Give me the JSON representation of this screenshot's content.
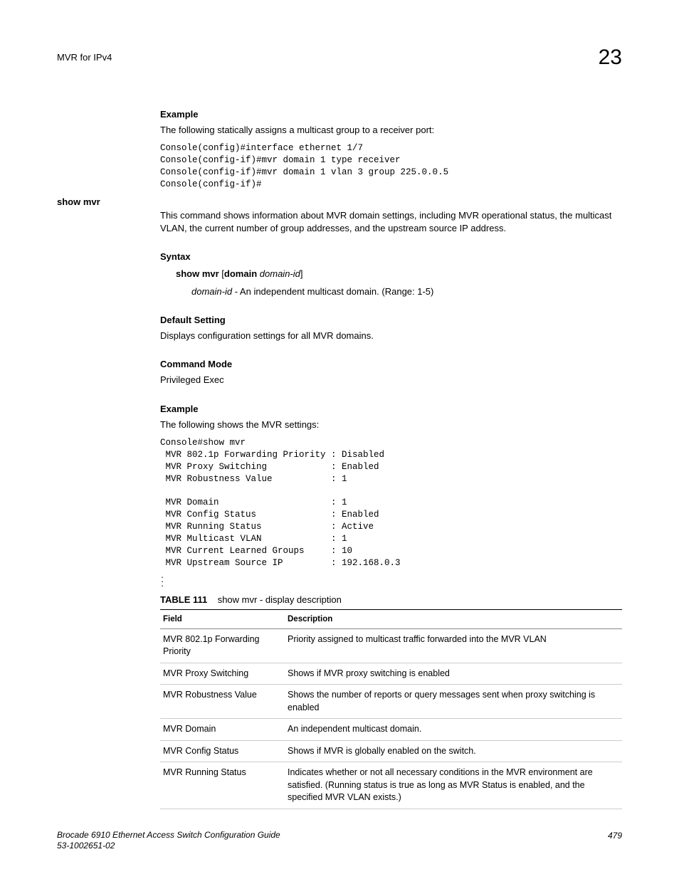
{
  "header": {
    "left": "MVR for IPv4",
    "right": "23"
  },
  "sections": {
    "example1_heading": "Example",
    "example1_text": "The following statically assigns a multicast group to a receiver port:",
    "example1_code": "Console(config)#interface ethernet 1/7\nConsole(config-if)#mvr domain 1 type receiver\nConsole(config-if)#mvr domain 1 vlan 3 group 225.0.0.5\nConsole(config-if)#",
    "left_label": "show mvr",
    "intro_text": "This command shows information about MVR domain settings, including MVR operational status, the multicast VLAN, the current number of group addresses, and the upstream source IP address.",
    "syntax_heading": "Syntax",
    "syntax_cmd_bold1": "show mvr",
    "syntax_cmd_plain1": " [",
    "syntax_cmd_bold2": "domain",
    "syntax_cmd_plain2": " ",
    "syntax_cmd_italic": "domain-id",
    "syntax_cmd_plain3": "]",
    "param_italic": "domain-id",
    "param_text": " - An independent multicast domain. (Range: 1-5)",
    "default_heading": "Default Setting",
    "default_text": "Displays configuration settings for all MVR domains.",
    "mode_heading": "Command Mode",
    "mode_text": "Privileged Exec",
    "example2_heading": "Example",
    "example2_text": "The following shows the MVR settings:",
    "example2_code": "Console#show mvr\n MVR 802.1p Forwarding Priority : Disabled\n MVR Proxy Switching            : Enabled\n MVR Robustness Value           : 1\n\n MVR Domain                     : 1\n MVR Config Status              : Enabled\n MVR Running Status             : Active\n MVR Multicast VLAN             : 1\n MVR Current Learned Groups     : 10\n MVR Upstream Source IP         : 192.168.0.3",
    "table_label": "TABLE 111",
    "table_caption": "show mvr - display description",
    "table_head_field": "Field",
    "table_head_desc": "Description",
    "table_rows": [
      {
        "field": "MVR 802.1p Forwarding Priority",
        "desc": "Priority assigned to multicast traffic forwarded into the MVR VLAN"
      },
      {
        "field": "MVR Proxy Switching",
        "desc": "Shows if MVR proxy switching is enabled"
      },
      {
        "field": "MVR Robustness Value",
        "desc": "Shows the number of reports or query messages sent when proxy switching is enabled"
      },
      {
        "field": "MVR Domain",
        "desc": "An independent multicast domain."
      },
      {
        "field": "MVR Config Status",
        "desc": "Shows if MVR is globally enabled on the switch."
      },
      {
        "field": "MVR Running Status",
        "desc": "Indicates whether or not all necessary conditions in the MVR environment are satisfied. (Running status is true as long as MVR Status is enabled, and the specified MVR VLAN exists.)"
      }
    ]
  },
  "footer": {
    "line1": "Brocade 6910 Ethernet Access Switch Configuration Guide",
    "line2": "53-1002651-02",
    "page": "479"
  }
}
